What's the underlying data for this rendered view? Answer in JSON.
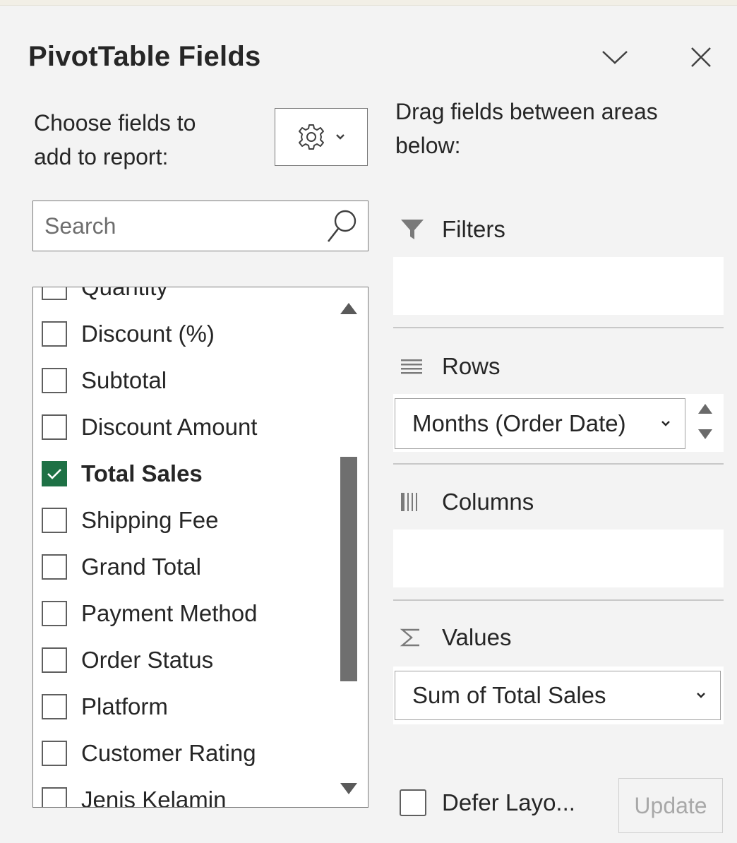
{
  "panel": {
    "title": "PivotTable Fields",
    "choose_label_line1": "Choose fields to",
    "choose_label_line2": "add to report:",
    "drag_label_line1": "Drag fields between areas",
    "drag_label_line2": "below:"
  },
  "search": {
    "placeholder": "Search",
    "value": ""
  },
  "fields": [
    {
      "label": "Quantity",
      "checked": false
    },
    {
      "label": "Discount (%)",
      "checked": false
    },
    {
      "label": "Subtotal",
      "checked": false
    },
    {
      "label": "Discount Amount",
      "checked": false
    },
    {
      "label": "Total Sales",
      "checked": true
    },
    {
      "label": "Shipping Fee",
      "checked": false
    },
    {
      "label": "Grand Total",
      "checked": false
    },
    {
      "label": "Payment Method",
      "checked": false
    },
    {
      "label": "Order Status",
      "checked": false
    },
    {
      "label": "Platform",
      "checked": false
    },
    {
      "label": "Customer Rating",
      "checked": false
    },
    {
      "label": "Jenis Kelamin",
      "checked": false
    }
  ],
  "areas": {
    "filters": {
      "label": "Filters"
    },
    "rows": {
      "label": "Rows",
      "item": "Months (Order Date)"
    },
    "columns": {
      "label": "Columns"
    },
    "values": {
      "label": "Values",
      "item": "Sum of Total Sales"
    }
  },
  "footer": {
    "defer_label": "Defer Layo...",
    "update_label": "Update"
  },
  "icons": {
    "collapse": "chevron-down-icon",
    "close": "close-icon",
    "settings": "gear-icon",
    "search": "search-icon",
    "filters": "funnel-icon",
    "rows": "rows-icon",
    "columns": "columns-icon",
    "values": "sigma-icon"
  },
  "colors": {
    "checked_fill": "#1e7145",
    "panel_bg": "#f3f3f3"
  }
}
